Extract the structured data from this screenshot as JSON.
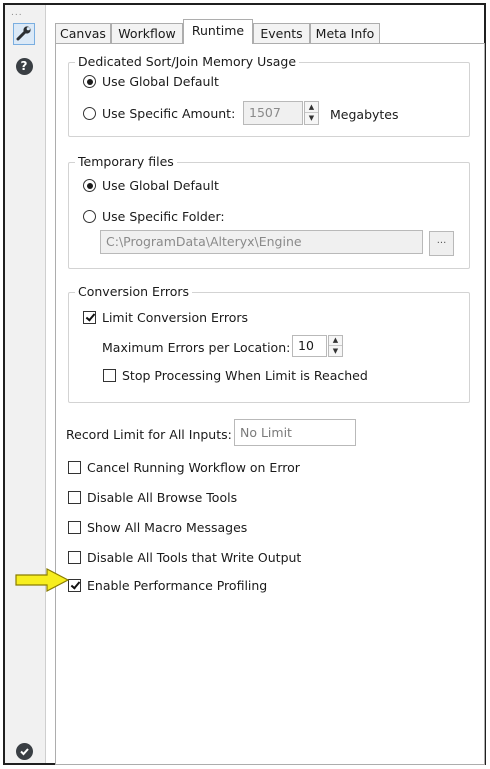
{
  "sidebar": {
    "menu_dots": "...",
    "help_glyph": "?",
    "tools": [
      "wrench-icon",
      "help-icon",
      "checkmark-icon"
    ]
  },
  "tabs": [
    {
      "label": "Canvas",
      "active": false
    },
    {
      "label": "Workflow",
      "active": false
    },
    {
      "label": "Runtime",
      "active": true
    },
    {
      "label": "Events",
      "active": false
    },
    {
      "label": "Meta Info",
      "active": false
    }
  ],
  "memory": {
    "title": "Dedicated Sort/Join Memory Usage",
    "option_global": "Use Global Default",
    "option_specific": "Use Specific Amount:",
    "selected": "global",
    "amount": "1507",
    "unit": "Megabytes"
  },
  "temp_files": {
    "title": "Temporary files",
    "option_global": "Use Global Default",
    "option_specific": "Use Specific Folder:",
    "selected": "global",
    "folder": "C:\\ProgramData\\Alteryx\\Engine",
    "browse_label": "..."
  },
  "conversion": {
    "title": "Conversion Errors",
    "limit_label": "Limit Conversion Errors",
    "limit_checked": true,
    "max_label": "Maximum Errors per Location:",
    "max_value": "10",
    "stop_label": "Stop Processing When Limit is Reached",
    "stop_checked": false
  },
  "record_limit": {
    "label": "Record Limit for All Inputs:",
    "placeholder": "No Limit"
  },
  "options": [
    {
      "label": "Cancel Running Workflow on Error",
      "checked": false
    },
    {
      "label": "Disable All Browse Tools",
      "checked": false
    },
    {
      "label": "Show All Macro Messages",
      "checked": false
    },
    {
      "label": "Disable All Tools that Write Output",
      "checked": false
    },
    {
      "label": "Enable Performance Profiling",
      "checked": true
    }
  ],
  "colors": {
    "highlight_arrow": "#f7ee1f",
    "arrow_outline": "#8a7d00",
    "active_tool_bg": "#dbe9f7"
  }
}
